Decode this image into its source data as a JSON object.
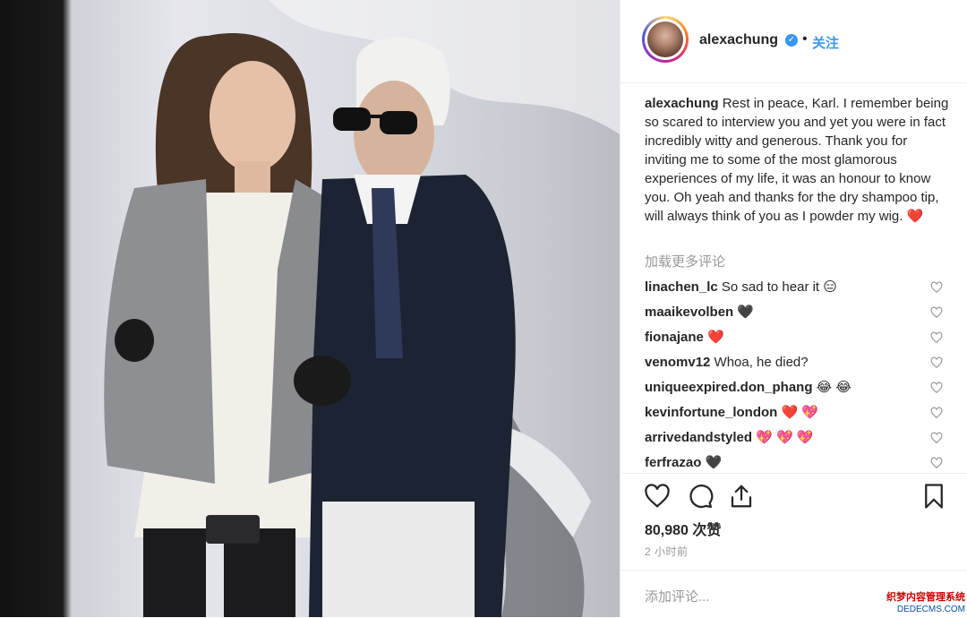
{
  "photo": {
    "alt": "photo"
  },
  "post": {
    "username": "alexachung",
    "separator": "•",
    "follow_label": "关注",
    "caption_user": "alexachung",
    "caption_text": " Rest in peace, Karl. I remember being so scared to interview you and yet you were in fact incredibly witty and generous. Thank you for inviting me to some of the most glamorous experiences of my life, it was an honour to know you. Oh yeah and thanks for the dry shampoo tip, will always think of you as I powder my wig. ❤️",
    "load_more": "加载更多评论",
    "comments": [
      {
        "user": "linachen_lc",
        "text": " So sad to hear it 😑"
      },
      {
        "user": "maaikevolben",
        "text": " 🖤"
      },
      {
        "user": "fionajane",
        "text": " ❤️"
      },
      {
        "user": "venomv12",
        "text": " Whoa, he died?"
      },
      {
        "user": "uniqueexpired.don_phang",
        "text": " 😂 😂"
      },
      {
        "user": "kevinfortune_london",
        "text": " ❤️ 💖"
      },
      {
        "user": "arrivedandstyled",
        "text": " 💖 💖 💖"
      },
      {
        "user": "ferfrazao",
        "text": " 🖤"
      }
    ],
    "likes": "80,980 次赞",
    "time": "2 小时前",
    "add_comment_placeholder": "添加评论..."
  },
  "watermark": {
    "line1": "织梦内容管理系统",
    "line2": "DEDECMS.COM"
  },
  "colors": {
    "accent": "#3897f0",
    "muted": "#999999",
    "text": "#262626"
  }
}
